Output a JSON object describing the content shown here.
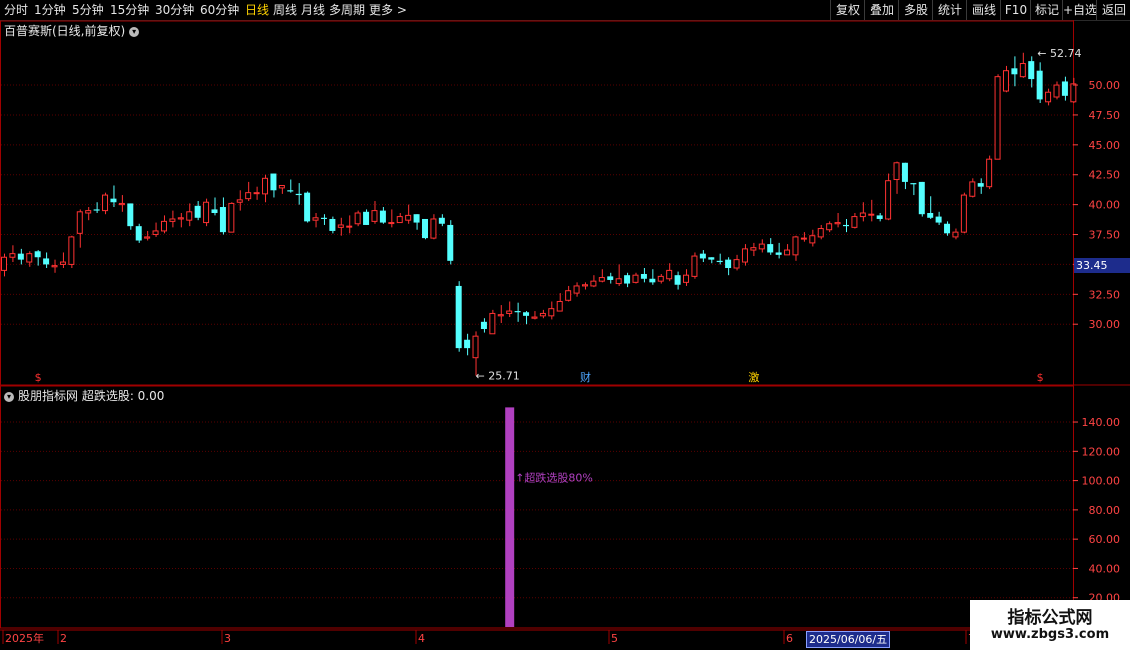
{
  "toolbar": {
    "periods": [
      "分时",
      "1分钟",
      "5分钟",
      "15分钟",
      "30分钟",
      "60分钟",
      "日线",
      "周线",
      "月线",
      "多周期",
      "更多 >"
    ],
    "active_period": "日线",
    "right_buttons": [
      "复权",
      "叠加",
      "多股",
      "统计",
      "画线",
      "F10",
      "标记",
      "+自选",
      "返回"
    ]
  },
  "chart_title": "百普赛斯(日线,前复权)",
  "indicator_title": "股朋指标网  超跌选股: 0.00",
  "current_price_label": "33.45",
  "annotations": {
    "high_label": "52.74",
    "low_label": "25.71",
    "signal_label": "超跌选股80%",
    "markers": [
      {
        "label": "$",
        "color": "#ff3030"
      },
      {
        "label": "财",
        "color": "#4da6ff"
      },
      {
        "label": "激",
        "color": "#ffd200"
      },
      {
        "label": "$",
        "color": "#ff3030"
      }
    ]
  },
  "date_axis": {
    "labels": [
      "2025年",
      "2",
      "3",
      "4",
      "5",
      "6",
      "7"
    ],
    "cursor_date": "2025/06/06/五"
  },
  "watermark": {
    "line1": "指标公式网",
    "line2": "www.zbgs3.com"
  },
  "colors": {
    "up": "#ff3232",
    "down": "#54ffff",
    "signal": "#b040c0",
    "grid": "#5a0000",
    "axis_text": "#ff4444",
    "border": "#a00000"
  },
  "chart_data": {
    "type": "candlestick",
    "price_axis": {
      "ticks": [
        30.0,
        32.5,
        35.0,
        37.5,
        40.0,
        42.5,
        45.0,
        47.5,
        50.0
      ],
      "range": [
        25.0,
        53.6
      ]
    },
    "indicator_axis": {
      "ticks": [
        20.0,
        40.0,
        60.0,
        80.0,
        100.0,
        120.0,
        140.0
      ],
      "range": [
        0,
        153
      ]
    },
    "indicator_series": {
      "name": "超跌选股",
      "values_by_index": {
        "60": 150
      }
    },
    "candles": [
      [
        34.5,
        35.6,
        35.9,
        34.0
      ],
      [
        35.6,
        35.9,
        36.6,
        35.2
      ],
      [
        35.9,
        35.4,
        36.3,
        35.0
      ],
      [
        35.2,
        35.9,
        36.1,
        34.8
      ],
      [
        36.1,
        35.6,
        36.2,
        34.9
      ],
      [
        35.5,
        35.0,
        36.0,
        34.7
      ],
      [
        34.8,
        34.9,
        35.4,
        34.3
      ],
      [
        35.0,
        35.2,
        36.0,
        34.7
      ],
      [
        35.0,
        37.3,
        37.4,
        34.7
      ],
      [
        37.6,
        39.4,
        39.6,
        36.4
      ],
      [
        39.3,
        39.5,
        39.8,
        38.7
      ],
      [
        39.6,
        39.5,
        40.2,
        39.3
      ],
      [
        39.5,
        40.8,
        41.0,
        39.2
      ],
      [
        40.5,
        40.2,
        41.6,
        39.8
      ],
      [
        40.0,
        40.1,
        40.8,
        39.4
      ],
      [
        40.1,
        38.2,
        40.1,
        37.9
      ],
      [
        38.2,
        37.0,
        38.4,
        36.8
      ],
      [
        37.2,
        37.3,
        37.8,
        37.0
      ],
      [
        37.5,
        37.8,
        38.5,
        37.3
      ],
      [
        37.8,
        38.6,
        39.1,
        37.6
      ],
      [
        38.6,
        38.8,
        39.5,
        38.1
      ],
      [
        38.8,
        38.9,
        39.3,
        38.1
      ],
      [
        38.7,
        39.4,
        40.1,
        38.2
      ],
      [
        39.9,
        38.9,
        40.3,
        38.7
      ],
      [
        38.5,
        40.2,
        40.5,
        38.2
      ],
      [
        39.6,
        39.3,
        40.6,
        39.1
      ],
      [
        39.8,
        37.7,
        40.6,
        37.5
      ],
      [
        37.7,
        40.1,
        40.2,
        37.7
      ],
      [
        40.2,
        40.4,
        41.2,
        39.5
      ],
      [
        40.5,
        41.0,
        41.9,
        40.3
      ],
      [
        41.0,
        41.0,
        41.5,
        40.4
      ],
      [
        40.9,
        42.2,
        42.5,
        40.2
      ],
      [
        42.6,
        41.2,
        42.6,
        40.6
      ],
      [
        41.4,
        41.6,
        41.6,
        40.9
      ],
      [
        41.2,
        41.1,
        42.1,
        41.0
      ],
      [
        40.9,
        40.8,
        41.8,
        40.0
      ],
      [
        41.0,
        38.6,
        41.1,
        38.5
      ],
      [
        38.7,
        38.9,
        39.3,
        38.1
      ],
      [
        38.9,
        38.8,
        39.2,
        38.3
      ],
      [
        38.8,
        37.8,
        39.0,
        37.6
      ],
      [
        38.1,
        38.3,
        38.9,
        37.4
      ],
      [
        38.2,
        38.2,
        39.1,
        37.6
      ],
      [
        38.4,
        39.3,
        39.5,
        38.2
      ],
      [
        39.4,
        38.3,
        39.6,
        38.3
      ],
      [
        38.6,
        39.5,
        40.3,
        38.4
      ],
      [
        39.5,
        38.5,
        39.8,
        38.4
      ],
      [
        38.5,
        38.5,
        39.6,
        38.1
      ],
      [
        38.5,
        39.0,
        39.3,
        38.6
      ],
      [
        38.7,
        39.1,
        40.0,
        38.4
      ],
      [
        39.2,
        38.5,
        39.2,
        37.9
      ],
      [
        38.8,
        37.2,
        38.8,
        37.1
      ],
      [
        37.2,
        38.8,
        39.2,
        37.1
      ],
      [
        38.9,
        38.4,
        39.2,
        38.2
      ],
      [
        38.3,
        35.3,
        38.7,
        35.0
      ],
      [
        33.2,
        28.0,
        33.6,
        27.7
      ],
      [
        28.7,
        28.0,
        29.2,
        27.4
      ],
      [
        27.2,
        29.0,
        29.4,
        25.7
      ],
      [
        30.2,
        29.6,
        30.5,
        29.3
      ],
      [
        29.2,
        30.9,
        31.2,
        29.2
      ],
      [
        30.7,
        30.8,
        31.6,
        30.1
      ],
      [
        30.9,
        31.1,
        31.9,
        30.6
      ],
      [
        31.1,
        31.0,
        31.8,
        30.2
      ],
      [
        31.0,
        30.7,
        31.1,
        30.0
      ],
      [
        30.5,
        30.6,
        31.1,
        30.4
      ],
      [
        30.7,
        30.9,
        31.2,
        30.5
      ],
      [
        30.7,
        31.3,
        31.9,
        30.4
      ],
      [
        31.1,
        31.9,
        32.6,
        31.1
      ],
      [
        32.0,
        32.8,
        33.2,
        31.9
      ],
      [
        32.6,
        33.2,
        33.5,
        32.3
      ],
      [
        33.2,
        33.3,
        33.5,
        32.9
      ],
      [
        33.2,
        33.6,
        34.1,
        33.1
      ],
      [
        33.6,
        33.9,
        34.6,
        33.5
      ],
      [
        34.0,
        33.7,
        34.3,
        33.4
      ],
      [
        33.4,
        33.8,
        35.0,
        33.2
      ],
      [
        34.1,
        33.4,
        34.3,
        33.1
      ],
      [
        33.5,
        34.1,
        34.3,
        33.4
      ],
      [
        34.2,
        33.8,
        34.7,
        33.5
      ],
      [
        33.8,
        33.5,
        34.6,
        33.3
      ],
      [
        33.6,
        34.0,
        34.2,
        33.4
      ],
      [
        33.8,
        34.5,
        35.1,
        33.6
      ],
      [
        34.1,
        33.3,
        34.4,
        32.9
      ],
      [
        33.5,
        34.1,
        34.6,
        33.2
      ],
      [
        34.0,
        35.7,
        36.0,
        33.8
      ],
      [
        35.9,
        35.5,
        36.2,
        35.2
      ],
      [
        35.6,
        35.4,
        35.6,
        35.1
      ],
      [
        35.3,
        35.2,
        35.9,
        35.0
      ],
      [
        35.4,
        34.7,
        35.6,
        34.1
      ],
      [
        34.7,
        35.4,
        35.8,
        34.5
      ],
      [
        35.2,
        36.3,
        36.7,
        34.9
      ],
      [
        36.2,
        36.4,
        36.8,
        35.7
      ],
      [
        36.3,
        36.7,
        37.1,
        36.0
      ],
      [
        36.7,
        36.0,
        37.2,
        35.8
      ],
      [
        36.0,
        35.8,
        36.8,
        35.5
      ],
      [
        35.8,
        36.2,
        36.7,
        35.8
      ],
      [
        35.8,
        37.3,
        37.4,
        35.3
      ],
      [
        37.2,
        37.2,
        37.7,
        36.9
      ],
      [
        36.8,
        37.4,
        37.9,
        36.5
      ],
      [
        37.3,
        38.0,
        38.3,
        37.1
      ],
      [
        37.9,
        38.4,
        38.6,
        37.7
      ],
      [
        38.4,
        38.5,
        39.3,
        38.1
      ],
      [
        38.3,
        38.2,
        38.8,
        37.7
      ],
      [
        38.1,
        39.0,
        39.3,
        38.0
      ],
      [
        39.0,
        39.3,
        40.2,
        38.6
      ],
      [
        39.2,
        39.2,
        40.4,
        38.6
      ],
      [
        39.1,
        38.8,
        39.3,
        38.6
      ],
      [
        38.8,
        42.0,
        42.6,
        38.7
      ],
      [
        42.1,
        43.5,
        43.6,
        40.9
      ],
      [
        43.5,
        41.9,
        43.5,
        41.3
      ],
      [
        41.8,
        41.7,
        41.8,
        40.8
      ],
      [
        41.9,
        39.2,
        41.9,
        39.0
      ],
      [
        39.3,
        38.9,
        40.7,
        38.8
      ],
      [
        39.0,
        38.5,
        39.4,
        38.3
      ],
      [
        38.4,
        37.6,
        38.6,
        37.4
      ],
      [
        37.3,
        37.7,
        38.0,
        37.1
      ],
      [
        37.7,
        40.8,
        41.0,
        37.6
      ],
      [
        40.7,
        41.9,
        42.2,
        40.6
      ],
      [
        41.8,
        41.5,
        42.2,
        40.9
      ],
      [
        41.5,
        43.8,
        44.1,
        41.3
      ],
      [
        43.8,
        50.7,
        50.9,
        43.8
      ],
      [
        49.5,
        51.2,
        51.6,
        49.4
      ],
      [
        51.4,
        50.9,
        52.4,
        49.9
      ],
      [
        50.7,
        51.8,
        52.7,
        50.6
      ],
      [
        52.0,
        50.5,
        52.4,
        49.8
      ],
      [
        51.2,
        48.8,
        51.9,
        48.5
      ],
      [
        48.6,
        49.4,
        49.7,
        48.3
      ],
      [
        49.0,
        50.0,
        50.3,
        48.8
      ],
      [
        50.3,
        49.1,
        50.7,
        48.7
      ],
      [
        48.6,
        50.1,
        50.6,
        48.5
      ]
    ]
  }
}
